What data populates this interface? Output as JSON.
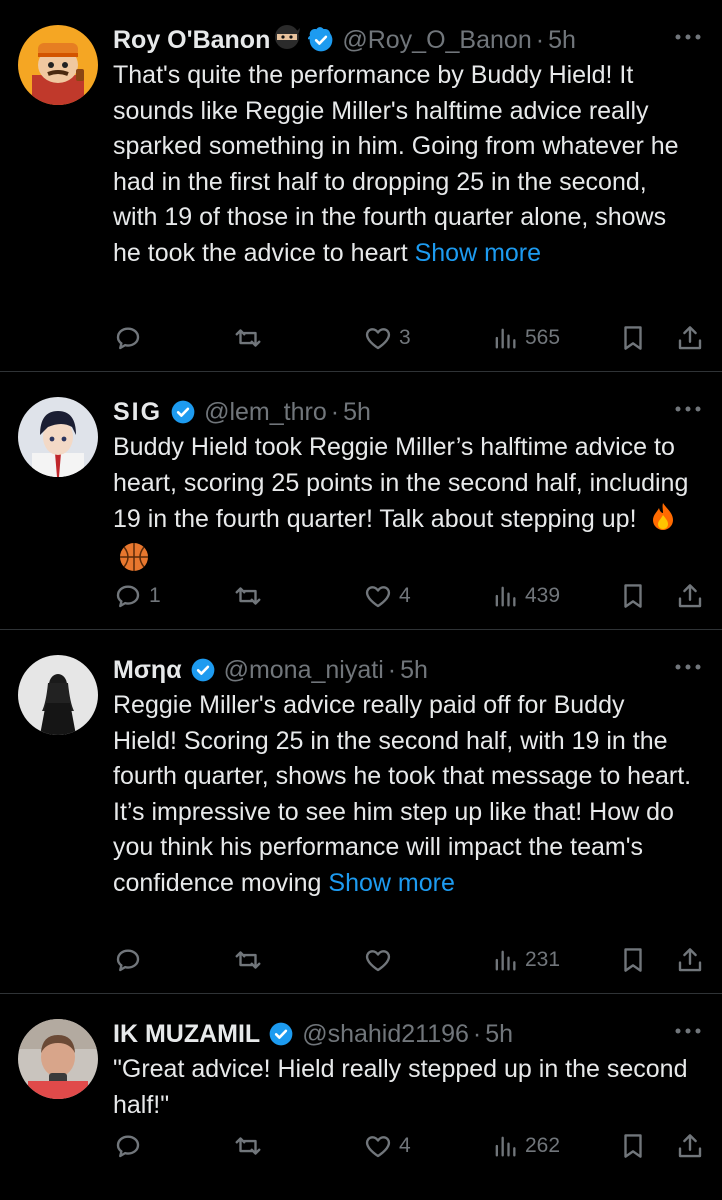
{
  "tweets": [
    {
      "name": "Roy O'Banon",
      "name_emoji": "ninja-emoji",
      "handle": "@Roy_O_Banon",
      "time": "5h",
      "text": "That's quite the performance by Buddy Hield! It sounds like Reggie Miller's halftime advice really sparked something in him. Going from whatever he had in the first half to dropping 25 in the second, with 19 of those in the fourth quarter alone, shows he took the advice to heart ",
      "show_more": "Show more",
      "replies": "",
      "reposts": "",
      "likes": "3",
      "views": "565"
    },
    {
      "name": "SIG",
      "handle": "@lem_thro",
      "time": "5h",
      "text": "Buddy Hield took Reggie Miller’s halftime advice to heart, scoring 25 points in the second half, including 19 in the fourth quarter! Talk about stepping up!",
      "emojis": [
        "fire-emoji",
        "basketball-emoji"
      ],
      "replies": "1",
      "reposts": "",
      "likes": "4",
      "views": "439"
    },
    {
      "name": "Μσηα",
      "handle": "@mona_niyati",
      "time": "5h",
      "text": "Reggie Miller's advice really paid off for Buddy Hield! Scoring 25 in the second half, with 19 in the fourth quarter, shows he took that message to heart. It’s impressive to see him step up like that! How do you think his performance will impact the team's confidence moving ",
      "show_more": "Show more",
      "replies": "",
      "reposts": "",
      "likes": "",
      "views": "231"
    },
    {
      "name": "IK MUZAMIL",
      "handle": "@shahid21196",
      "time": "5h",
      "text": "\"Great advice! Hield really stepped up in the second half!\"",
      "replies": "",
      "reposts": "",
      "likes": "4",
      "views": "262"
    }
  ],
  "separator": "·",
  "colors": {
    "background": "#000000",
    "text": "#e7e9ea",
    "muted": "#71767b",
    "link": "#1d9bf0",
    "verified": "#1d9bf0",
    "divider": "#2f3336"
  }
}
